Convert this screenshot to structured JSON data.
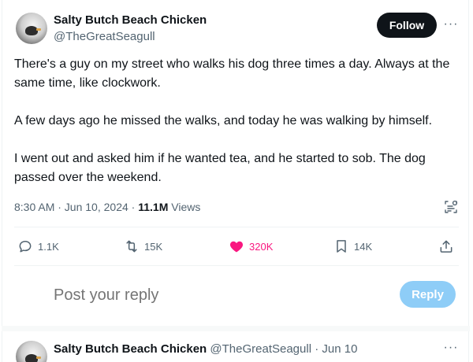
{
  "tweet": {
    "author_name": "Salty Butch Beach Chicken",
    "author_handle": "@TheGreatSeagull",
    "follow_label": "Follow",
    "more_label": "···",
    "paragraphs": [
      "There's a guy on my street who walks his dog three times a day. Always at the same time, like clockwork.",
      "A few days ago he missed the walks, and today he was walking by himself.",
      "I went out and asked him if he wanted tea, and he started to sob. The dog passed over the weekend."
    ],
    "timestamp": "8:30 AM · Jun 10, 2024",
    "meta_sep": " · ",
    "views_count": "11.1M",
    "views_label": "Views"
  },
  "actions": {
    "replies": "1.1K",
    "retweets": "15K",
    "likes": "320K",
    "bookmarks": "14K"
  },
  "composer": {
    "placeholder": "Post your reply",
    "reply_button": "Reply"
  },
  "reply": {
    "author_name": "Salty Butch Beach Chicken",
    "author_handle": "@TheGreatSeagull",
    "dot": " · ",
    "date": "Jun 10",
    "more_label": "···"
  },
  "colors": {
    "text": "#0f1419",
    "secondary": "#536471",
    "like_pink": "#f91880",
    "reply_button_disabled": "#8ecdf7",
    "follow_button": "#0f1419"
  },
  "icons": {
    "reply": "speech-bubble-icon",
    "retweet": "retweet-arrows-icon",
    "like": "heart-filled-icon",
    "bookmark": "bookmark-icon",
    "share": "share-upload-icon",
    "grok": "grok-analyze-icon"
  }
}
